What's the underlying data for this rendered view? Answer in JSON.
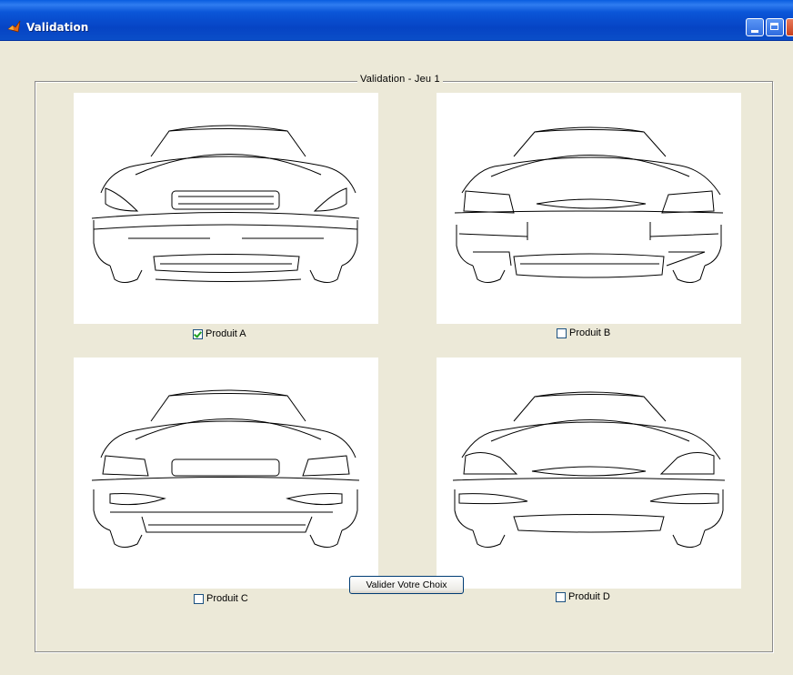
{
  "window": {
    "title": "Validation"
  },
  "panel": {
    "title": "Validation - Jeu 1"
  },
  "products": [
    {
      "label": "Produit A",
      "checked": true
    },
    {
      "label": "Produit B",
      "checked": false
    },
    {
      "label": "Produit C",
      "checked": false
    },
    {
      "label": "Produit D",
      "checked": false
    }
  ],
  "submit_button": {
    "label": "Valider Votre Choix"
  },
  "icons": {
    "app": "matlab-icon",
    "minimize": "minimize-icon",
    "maximize": "maximize-icon",
    "close": "close-icon"
  }
}
